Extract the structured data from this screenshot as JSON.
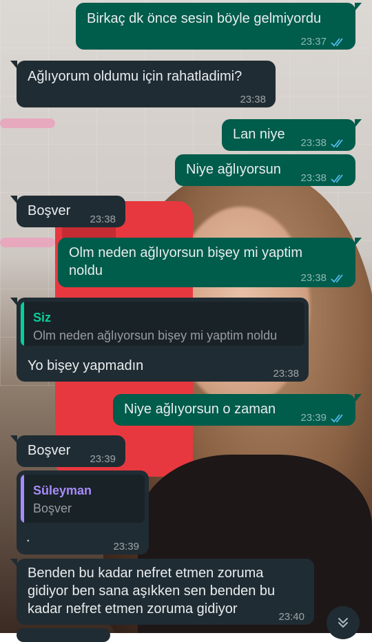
{
  "colors": {
    "outgoing_bubble": "#005c4b",
    "incoming_bubble": "#202c33",
    "read_ticks": "#53bdeb",
    "quote_you": "#06cf9c",
    "quote_contact": "#a78bfa"
  },
  "messages": [
    {
      "dir": "out",
      "text": "Birkaç dk önce sesin böyle gelmiyordu",
      "time": "23:37",
      "read": true
    },
    {
      "dir": "in",
      "text": "Ağlıyorum oldumu için rahatladimi?",
      "time": "23:38"
    },
    {
      "dir": "out",
      "text": "Lan niye",
      "time": "23:38",
      "read": true
    },
    {
      "dir": "out",
      "text": "Niye ağlıyorsun",
      "time": "23:38",
      "read": true
    },
    {
      "dir": "in",
      "text": "Boşver",
      "time": "23:38"
    },
    {
      "dir": "out",
      "text_line1": "Olm neden ağlıyorsun bişey mi yaptim",
      "text_line2": "noldu",
      "time": "23:38",
      "read": true
    },
    {
      "dir": "in",
      "quote_author": "Siz",
      "quote_text": "Olm neden ağlıyorsun bişey mi yaptim noldu",
      "text": "Yo bişey yapmadın",
      "time": "23:38"
    },
    {
      "dir": "out",
      "text": "Niye ağlıyorsun o zaman",
      "time": "23:39",
      "read": true
    },
    {
      "dir": "in",
      "text": "Boşver",
      "time": "23:39"
    },
    {
      "dir": "in",
      "quote_author": "Süleyman",
      "quote_text": "Boşver",
      "text": ".",
      "time": "23:39"
    },
    {
      "dir": "in",
      "text_line1": "Benden bu kadar nefret etmen zoruma",
      "text_line2": "gidiyor ben sana aşıkken sen benden bu",
      "text_line3": "kadar nefret etmen zoruma gidiyor",
      "time": "23:40"
    }
  ],
  "scroll_button_icon": "chevron-double-down-icon"
}
